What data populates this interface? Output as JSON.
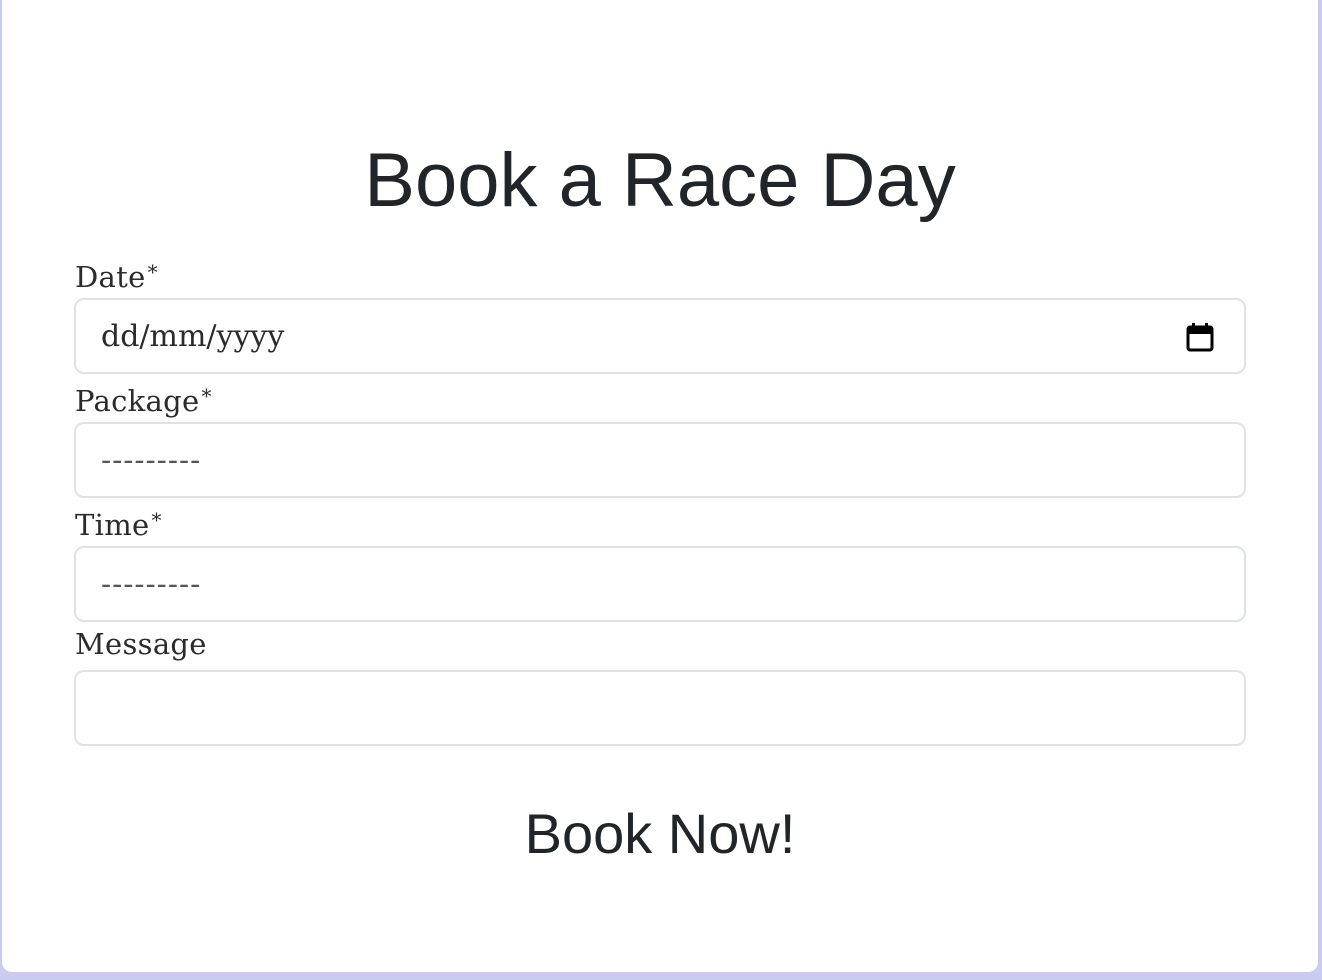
{
  "form": {
    "title": "Book a Race Day",
    "date": {
      "label": "Date",
      "required_mark": "*",
      "placeholder": "dd/mm/yyyy"
    },
    "package": {
      "label": "Package",
      "required_mark": "*",
      "value": "---------"
    },
    "time": {
      "label": "Time",
      "required_mark": "*",
      "value": "---------"
    },
    "message": {
      "label": "Message",
      "value": ""
    },
    "submit_label": "Book Now!"
  },
  "icons": {
    "date_picker": "calendar-icon"
  },
  "colors": {
    "background": "#c9ccf0",
    "card": "#ffffff",
    "text": "#212529",
    "border": "#dee2e6"
  }
}
